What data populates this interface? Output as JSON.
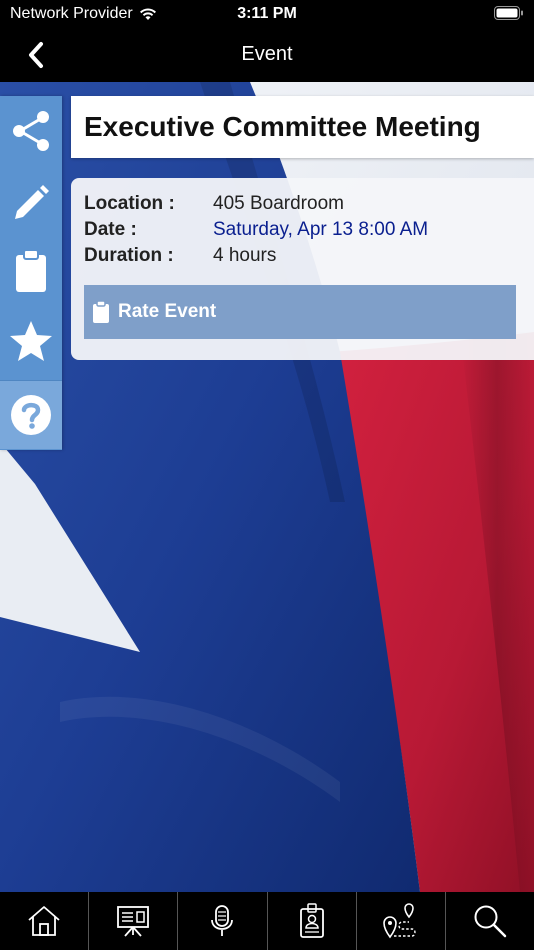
{
  "status_bar": {
    "carrier": "Network Provider",
    "time": "3:11 PM"
  },
  "nav": {
    "title": "Event",
    "back_icon": "chevron-left-icon"
  },
  "sidebar": {
    "items": [
      {
        "name": "share",
        "icon": "share-icon"
      },
      {
        "name": "edit",
        "icon": "pencil-icon"
      },
      {
        "name": "notes",
        "icon": "clipboard-icon"
      },
      {
        "name": "favorite",
        "icon": "star-icon"
      },
      {
        "name": "help",
        "icon": "help-icon"
      }
    ]
  },
  "event": {
    "title": "Executive Committee Meeting",
    "location_label": "Location :",
    "location_value": "405 Boardroom",
    "date_label": "Date :",
    "date_value": "Saturday, Apr 13 8:00 AM",
    "duration_label": "Duration :",
    "duration_value": "4 hours",
    "rate_label": "Rate Event"
  },
  "tab_bar": {
    "items": [
      {
        "name": "home",
        "icon": "home-icon"
      },
      {
        "name": "schedule",
        "icon": "presentation-board-icon"
      },
      {
        "name": "speakers",
        "icon": "microphone-icon"
      },
      {
        "name": "attendees",
        "icon": "id-badge-icon"
      },
      {
        "name": "maps",
        "icon": "map-route-icon"
      },
      {
        "name": "search",
        "icon": "search-icon"
      }
    ]
  },
  "colors": {
    "sidebar": "#5b93d0",
    "rate_button": "#7f9fc9",
    "date_text": "#0a1f8f",
    "flag_blue": "#1f3f8f",
    "flag_red": "#c41e3a"
  }
}
